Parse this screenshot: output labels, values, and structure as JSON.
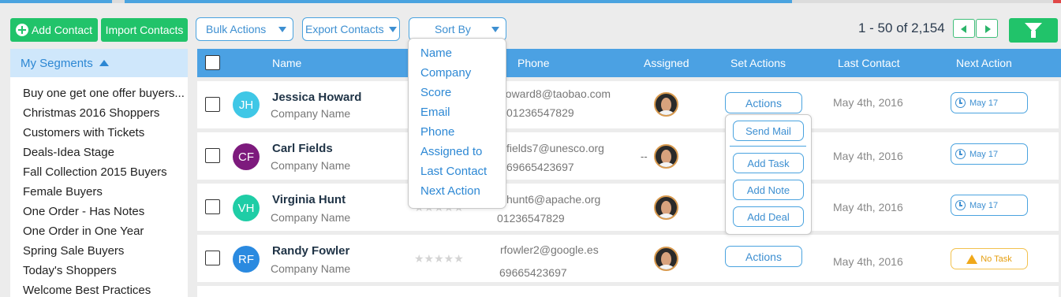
{
  "toolbar": {
    "add_contact": "Add Contact",
    "import_contacts": "Import Contacts",
    "bulk_actions": "Bulk Actions",
    "export_contacts": "Export Contacts",
    "sort_by": "Sort By",
    "filter_icon": "filter-funnel-icon"
  },
  "pagination": {
    "range": "1 - 50",
    "total": "of 2,154"
  },
  "sidebar": {
    "header": "My Segments",
    "items": [
      "Buy one get one offer buyers...",
      "Christmas 2016 Shoppers",
      "Customers with Tickets",
      "Deals-Idea Stage",
      "Fall Collection 2015 Buyers",
      "Female Buyers",
      "One Order - Has Notes",
      "One Order in One Year",
      "Spring Sale Buyers",
      "Today's Shoppers",
      "Welcome Best Practices"
    ]
  },
  "table": {
    "columns": {
      "name": "Name",
      "phone": "Phone",
      "assigned": "Assigned",
      "set_actions": "Set Actions",
      "last_contact": "Last Contact",
      "next_action": "Next Action"
    },
    "rows": [
      {
        "initials": "JH",
        "name": "Jessica Howard",
        "company": "Company Name",
        "email": "howard8@taobao.com",
        "phone": "01236547829",
        "actions": "Actions",
        "last_contact": "May 4th, 2016",
        "next": "May 17",
        "avatar_color": "#3fc7e6"
      },
      {
        "initials": "CF",
        "name": "Carl Fields",
        "company": "Company Name",
        "email": "fields7@unesco.org",
        "phone": "69665423697",
        "assigned_prefix": "--",
        "last_contact": "May 4th, 2016",
        "next": "May 17",
        "avatar_color": "#7d1a7d"
      },
      {
        "initials": "VH",
        "name": "Virginia Hunt",
        "company": "Company Name",
        "email": "hunt6@apache.org",
        "phone": "01236547829",
        "last_contact": "May 4th, 2016",
        "next": "May 17",
        "avatar_color": "#1fcda6"
      },
      {
        "initials": "RF",
        "name": "Randy Fowler",
        "company": "Company Name",
        "email": "rfowler2@google.es",
        "phone": "69665423697",
        "actions": "Actions",
        "last_contact": "May 4th, 2016",
        "next": "No Task",
        "avatar_color": "#2a8ae0"
      }
    ]
  },
  "sort_menu": {
    "options": [
      "Name",
      "Company",
      "Score",
      "Email",
      "Phone",
      "Assigned to",
      "Last Contact",
      "Next Action"
    ]
  },
  "actions_menu": {
    "items": [
      "Send Mail",
      "Add Task",
      "Add Note",
      "Add Deal"
    ]
  },
  "colors": {
    "accent_blue": "#4ba1e3",
    "green": "#21c36a",
    "warning": "#f0a81a"
  }
}
